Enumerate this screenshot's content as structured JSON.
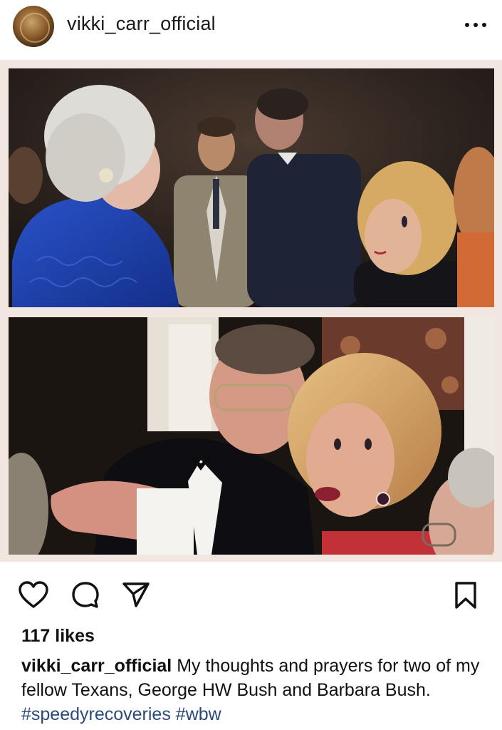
{
  "header": {
    "username": "vikki_carr_official",
    "avatar_icon": "profile-avatar",
    "more_icon": "more-options-icon"
  },
  "post": {
    "frame_color": "#f1e6e0",
    "photos": [
      "photo-top",
      "photo-bottom"
    ]
  },
  "actions": {
    "like_icon": "heart-icon",
    "comment_icon": "comment-icon",
    "share_icon": "send-icon",
    "save_icon": "bookmark-icon"
  },
  "likes": "117 likes",
  "caption": {
    "username": "vikki_carr_official",
    "text": " My thoughts and prayers for two of my fellow Texans, George HW Bush and Barbara Bush. ",
    "hashtags": [
      "#speedyrecoveries",
      "#wbw"
    ]
  },
  "colors": {
    "hashtag": "#2b4a78",
    "text": "#111111"
  }
}
